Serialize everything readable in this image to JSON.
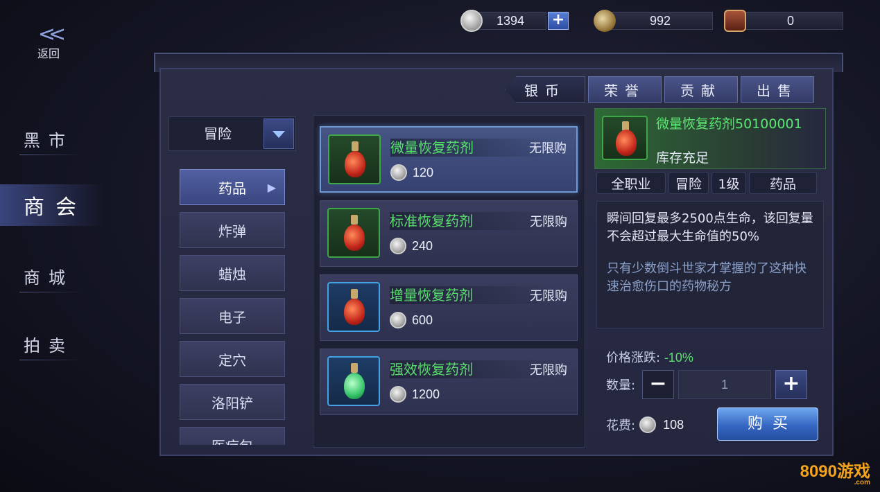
{
  "currencies": [
    {
      "value": "1394",
      "icon": "silver-coin-icon",
      "has_plus": true
    },
    {
      "value": "992",
      "icon": "horn-icon",
      "has_plus": false
    },
    {
      "value": "0",
      "icon": "contribution-token-icon",
      "has_plus": false
    }
  ],
  "back": {
    "label": "返回"
  },
  "nav": [
    {
      "label": "黑市",
      "active": false
    },
    {
      "label": "商会",
      "active": true
    },
    {
      "label": "商城",
      "active": false
    },
    {
      "label": "拍卖",
      "active": false
    }
  ],
  "tabs": [
    {
      "label": "银币",
      "active": true
    },
    {
      "label": "荣誉",
      "active": false
    },
    {
      "label": "贡献",
      "active": false
    },
    {
      "label": "出售",
      "active": false
    }
  ],
  "category_dropdown": {
    "label": "冒险"
  },
  "subcategories": [
    {
      "label": "药品",
      "active": true
    },
    {
      "label": "炸弹",
      "active": false
    },
    {
      "label": "蜡烛",
      "active": false
    },
    {
      "label": "电子",
      "active": false
    },
    {
      "label": "定穴",
      "active": false
    },
    {
      "label": "洛阳铲",
      "active": false
    },
    {
      "label": "医疗包",
      "active": false
    }
  ],
  "items": [
    {
      "name": "微量恢复药剂",
      "limit": "无限购",
      "price": "120",
      "frame": "green",
      "potion": "red",
      "active": true
    },
    {
      "name": "标准恢复药剂",
      "limit": "无限购",
      "price": "240",
      "frame": "green",
      "potion": "red",
      "active": false
    },
    {
      "name": "增量恢复药剂",
      "limit": "无限购",
      "price": "600",
      "frame": "blue",
      "potion": "red",
      "active": false
    },
    {
      "name": "强效恢复药剂",
      "limit": "无限购",
      "price": "1200",
      "frame": "blue",
      "potion": "green",
      "active": false
    }
  ],
  "detail": {
    "name": "微量恢复药剂50100001",
    "stock": "库存充足",
    "tags": [
      "全职业",
      "冒险",
      "1级",
      "药品"
    ],
    "desc1": "瞬间回复最多2500点生命，该回复量不会超过最大生命值的50%",
    "desc2": "只有少数倒斗世家才掌握的了这种快速治愈伤口的药物秘方",
    "price_change_label": "价格涨跌:",
    "price_change_value": "-10%",
    "qty_label": "数量:",
    "qty_value": "1",
    "cost_label": "花费:",
    "cost_value": "108",
    "buy_label": "购买"
  },
  "watermark": {
    "text": "8090游戏",
    "sub": ".com"
  },
  "colors": {
    "item_name": "#58e06c",
    "accent_blue": "#3566c2"
  }
}
